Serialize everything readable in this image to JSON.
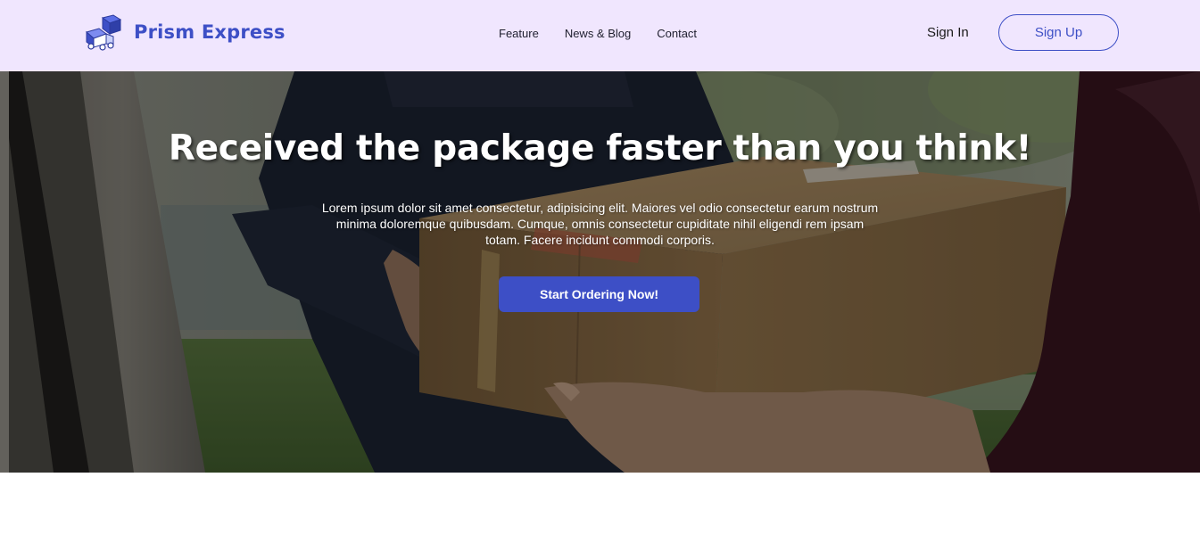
{
  "header": {
    "brand": "Prism Express",
    "logo_icon": "delivery-truck-box-icon",
    "nav": [
      {
        "label": "Feature"
      },
      {
        "label": "News & Blog"
      },
      {
        "label": "Contact"
      }
    ],
    "sign_in_label": "Sign In",
    "sign_up_label": "Sign Up"
  },
  "hero": {
    "title": "Received the package faster than you think!",
    "description": "Lorem ipsum dolor sit amet consectetur, adipisicing elit. Maiores vel odio consectetur earum nostrum minima doloremque quibusdam. Cumque, omnis consectetur cupiditate nihil eligendi rem ipsam totam. Facere incidunt commodi corporis.",
    "cta_label": "Start Ordering Now!",
    "image": "courier-handing-package-photo"
  },
  "colors": {
    "accent": "#3d4fc6",
    "nav_bg": "#f0e6fe",
    "text_dark": "#1a1a1a"
  }
}
